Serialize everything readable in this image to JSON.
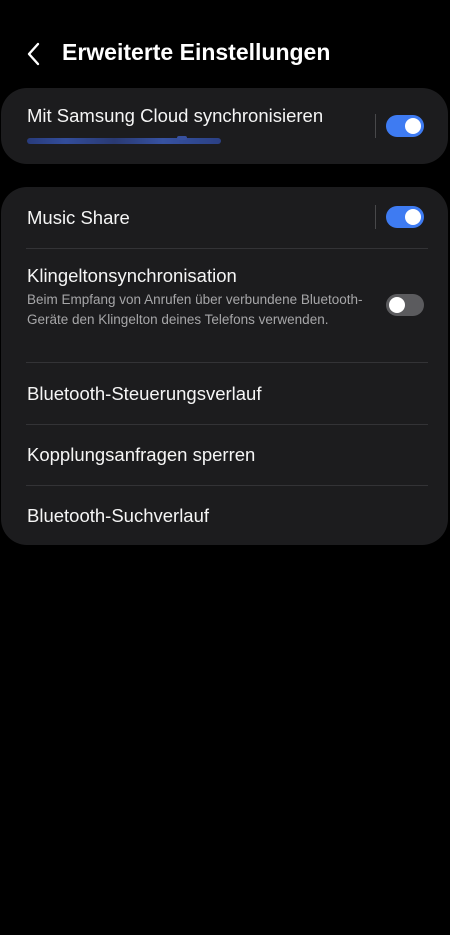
{
  "header": {
    "title": "Erweiterte Einstellungen",
    "back_icon": "chevron-left-icon"
  },
  "sync_card": {
    "title": "Mit Samsung Cloud synchronisieren",
    "toggle_on": true
  },
  "settings": {
    "music_share": {
      "title": "Music Share",
      "toggle_on": true
    },
    "ringtone_sync": {
      "title": "Klingeltonsynchronisation",
      "description": "Beim Empfang von Anrufen über verbundene Bluetooth-Geräte den Klingelton deines Telefons verwenden.",
      "toggle_on": false
    },
    "bt_control_history": {
      "title": "Bluetooth-Steuerungsverlauf"
    },
    "block_pairing": {
      "title": "Kopplungsanfragen sperren"
    },
    "bt_search_history": {
      "title": "Bluetooth-Suchverlauf"
    }
  },
  "colors": {
    "background": "#000000",
    "card": "#1c1c1e",
    "toggle_on": "#3e7bf2",
    "toggle_off": "#5b5b5e",
    "secondary_text": "#a6a6a8"
  }
}
